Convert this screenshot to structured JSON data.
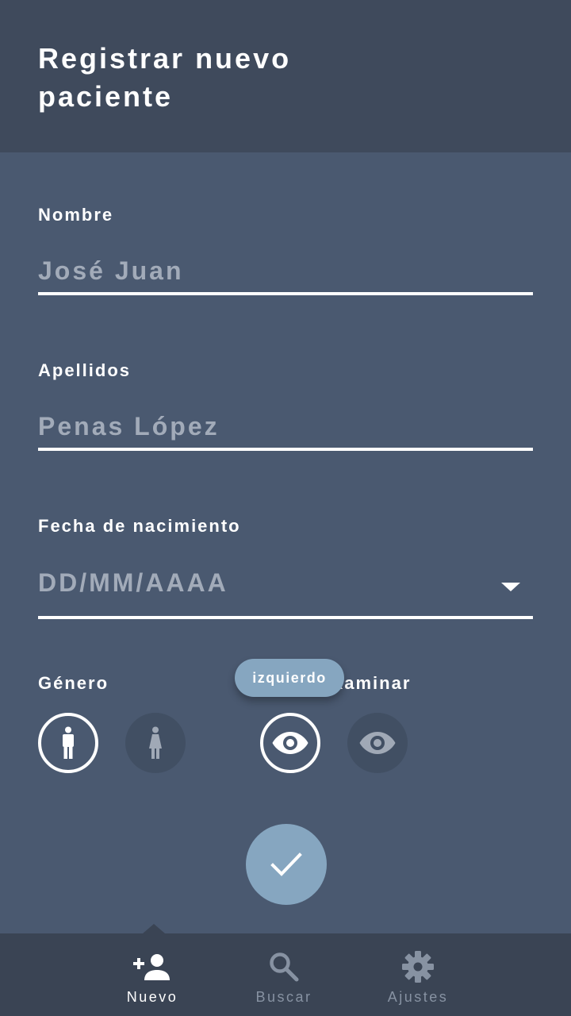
{
  "header": {
    "title": "Registrar nuevo paciente"
  },
  "form": {
    "nombre": {
      "label": "Nombre",
      "placeholder": "José Juan"
    },
    "apellidos": {
      "label": "Apellidos",
      "placeholder": "Penas López"
    },
    "fecha": {
      "label": "Fecha de nacimiento",
      "placeholder": "DD/MM/AAAA"
    },
    "genero": {
      "label": "Género",
      "options": [
        {
          "icon": "male-icon",
          "selected": true
        },
        {
          "icon": "female-icon",
          "selected": false
        }
      ]
    },
    "ojo": {
      "label": "Ojo a examinar",
      "label_visible": "xaminar",
      "options": [
        {
          "icon": "eye-icon",
          "selected": true
        },
        {
          "icon": "eye-icon",
          "selected": false
        }
      ]
    },
    "tooltip": "izquierdo"
  },
  "submit": {
    "icon": "check-icon"
  },
  "nav": {
    "items": [
      {
        "label": "Nuevo",
        "icon": "add-person-icon",
        "active": true
      },
      {
        "label": "Buscar",
        "icon": "search-icon",
        "active": false
      },
      {
        "label": "Ajustes",
        "icon": "gear-icon",
        "active": false
      }
    ]
  },
  "colors": {
    "background": "#4a5970",
    "header": "#3f4a5c",
    "accent": "#86a6c0",
    "nav": "#3a4454",
    "placeholder": "#a2abb9"
  }
}
